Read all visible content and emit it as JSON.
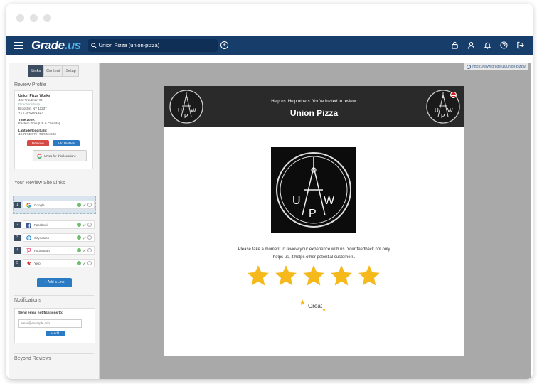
{
  "app": {
    "logo_main": "Grade",
    "logo_accent": ".us",
    "search_value": "Union Pizza (union-pizza)"
  },
  "sidebar": {
    "tabs": [
      {
        "label": "Links",
        "active": true
      },
      {
        "label": "Content",
        "active": false
      },
      {
        "label": "Setup",
        "active": false
      }
    ],
    "review_profile_title": "Review Profile",
    "profile": {
      "name": "Union Pizza Works",
      "street": "423 Troutman St",
      "link": "Directions/Map",
      "city": "Brooklyn, NY 11237",
      "phone": "+1 718-628-1927",
      "timezone_label": "Time zone:",
      "timezone_value": "Eastern Time (US & Canada)",
      "latlng_label": "Latitude/longitude:",
      "latlng_value": "40.7074277 / -73.9224693",
      "remove_label": "Remove",
      "add_profiles_label": "Add Profiles",
      "urls_label": "URLs for this location ›"
    },
    "site_links_title": "Your Review Site Links",
    "sites": [
      {
        "num": "1",
        "name": "Google"
      },
      {
        "num": "2",
        "name": "Facebook"
      },
      {
        "num": "3",
        "name": "Citysearch"
      },
      {
        "num": "4",
        "name": "Foursquare"
      },
      {
        "num": "5",
        "name": "Yelp"
      }
    ],
    "add_link_label": "+ Add a Link",
    "notifications_title": "Notifications",
    "notif_label": "Send email notifications to:",
    "email_placeholder": "email@example.com",
    "add_label": "+ Add",
    "beyond_title": "Beyond Reviews"
  },
  "main": {
    "url": "https://www.grade.us/union-pizza/",
    "banner_line1": "Help us. Help others. You're invited to review:",
    "banner_line2": "Union Pizza",
    "logo_letters": {
      "u": "U",
      "p": "P",
      "w": "W"
    },
    "prompt": "Please take a moment to review your experience with us. Your feedback not only helps us, it helps other potential customers.",
    "star_count": 5,
    "rating_label": "Great"
  },
  "colors": {
    "topbar": "#173d6b",
    "star": "#f6b91b",
    "accent_blue": "#2a7ac4"
  }
}
